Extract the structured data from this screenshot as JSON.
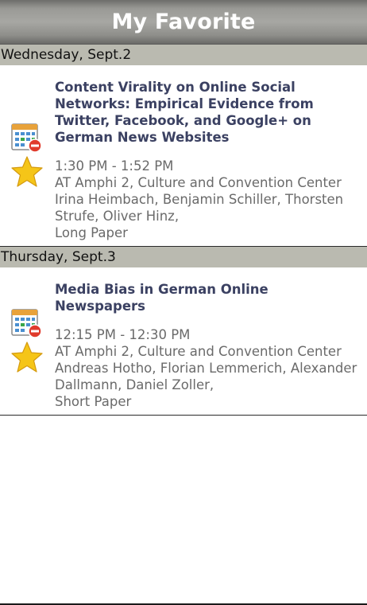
{
  "header": {
    "title": "My Favorite"
  },
  "days": [
    {
      "label": "Wednesday, Sept.2",
      "sessions": [
        {
          "title": "Content Virality on Online Social Networks: Empirical Evidence from Twitter, Facebook, and Google+ on German News Websites",
          "time": "1:30 PM - 1:52 PM",
          "location": "AT Amphi 2, Culture and Convention Center",
          "authors": "Irina Heimbach, Benjamin Schiller, Thorsten Strufe, Oliver Hinz,",
          "type": "Long Paper"
        }
      ]
    },
    {
      "label": "Thursday, Sept.3",
      "sessions": [
        {
          "title": "Media Bias in German Online Newspapers",
          "time": "12:15 PM - 12:30 PM",
          "location": "AT Amphi 2, Culture and Convention Center",
          "authors": "Andreas Hotho, Florian Lemmerich, Alexander Dallmann, Daniel Zoller,",
          "type": "Short Paper"
        }
      ]
    }
  ],
  "icons": {
    "calendar": "calendar-remove-icon",
    "star": "star-icon"
  },
  "colors": {
    "title_text": "#3b4162",
    "info_text": "#6a6a6a",
    "day_header_bg": "#babab0",
    "star_fill": "#f5c518",
    "remove_badge": "#e03b2c"
  }
}
